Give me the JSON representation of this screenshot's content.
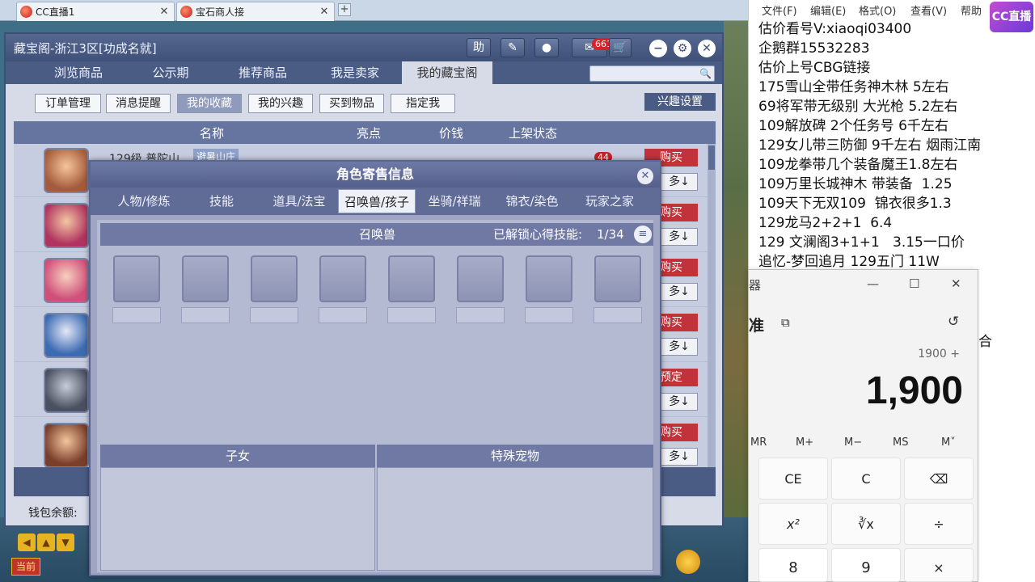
{
  "browser": {
    "tabs": [
      {
        "label": "CC直播1",
        "close": "✕"
      },
      {
        "label": "宝石商人接",
        "close": "✕"
      }
    ],
    "add_tab": "+"
  },
  "cbg": {
    "title": "藏宝阁-浙江3区[功成名就]",
    "title_buttons": {
      "help": "助",
      "msg_count": "661"
    },
    "nav_tabs": [
      "浏览商品",
      "公示期",
      "推荐商品",
      "我是卖家",
      "我的藏宝阁"
    ],
    "sub_buttons": [
      "订单管理",
      "消息提醒",
      "我的收藏",
      "我的兴趣",
      "买到物品",
      "指定我"
    ],
    "interest_settings": "兴趣设置",
    "columns": [
      "名称",
      "亮点",
      "价钱",
      "上架状态"
    ],
    "rows": [
      {
        "name": "129级 普陀山",
        "server": "避暑山庄",
        "num": "44",
        "action": "购买",
        "more": "多↓"
      },
      {
        "action": "购买",
        "more": "多↓"
      },
      {
        "action": "购买",
        "more": "多↓"
      },
      {
        "action": "购买",
        "more": "多↓"
      },
      {
        "action": "预定",
        "more": "多↓"
      },
      {
        "action": "购买",
        "more": "多↓"
      }
    ],
    "wallet_label": "钱包余额:"
  },
  "dialog": {
    "title": "角色寄售信息",
    "tabs": [
      "人物/修炼",
      "技能",
      "道具/法宝",
      "召唤兽/孩子",
      "坐骑/祥瑞",
      "锦衣/染色",
      "玩家之家"
    ],
    "section_pets": "召唤兽",
    "unlock_text": "已解锁心得技能:",
    "unlock_count": "1/34",
    "section_children": "子女",
    "section_special": "特殊宠物"
  },
  "notepad": {
    "menu": [
      "文件(F)",
      "编辑(E)",
      "格式(O)",
      "查看(V)",
      "帮助"
    ],
    "lines": [
      "估价看号V:xiaoqi03400",
      "企鹅群15532283",
      "估价上号CBG链接",
      "175雪山全带任务神木林 5左右",
      "69将军带无级别 大光枪 5.2左右",
      "109解放碑 2个任务号 6千左右",
      "129女儿带三防御 9千左右 烟雨江南",
      "109龙拳带几个装备魔王1.8左右",
      "109万里长城神木 带装备  1.25",
      "109天下无双109  锦衣很多1.3",
      "129龙马2+2+1  6.4",
      "129 文澜阁3+1+1   3.15一口价",
      "追忆-梦回追月 129五门 11W"
    ],
    "logo": "CC直播"
  },
  "calculator": {
    "title": "器",
    "mode": "准",
    "expression": "1900 +",
    "display": "1,900",
    "memory": [
      "MR",
      "M+",
      "M−",
      "MS",
      "M˅"
    ],
    "keys": [
      "CE",
      "C",
      "⌫",
      "x²",
      "∛x",
      "÷",
      "8",
      "9",
      "×"
    ],
    "side_text": "合"
  }
}
